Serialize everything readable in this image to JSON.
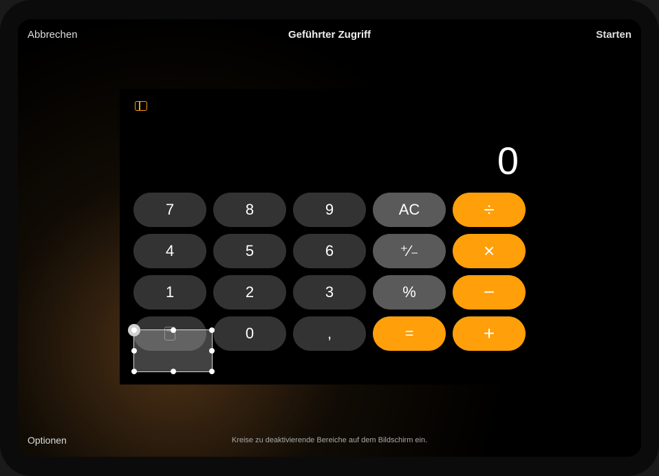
{
  "header": {
    "cancel": "Abbrechen",
    "title": "Geführter Zugriff",
    "start": "Starten"
  },
  "calculator": {
    "display": "0",
    "keys": {
      "r1": [
        "7",
        "8",
        "9",
        "AC",
        "÷"
      ],
      "r2": [
        "4",
        "5",
        "6",
        "⁺∕₋",
        "×"
      ],
      "r3": [
        "1",
        "2",
        "3",
        "%",
        "−"
      ],
      "r4": [
        "",
        "0",
        ",",
        "=",
        "+"
      ]
    }
  },
  "footer": {
    "options": "Optionen",
    "hint": "Kreise zu deaktivierende Bereiche auf dem Bildschirm ein."
  }
}
